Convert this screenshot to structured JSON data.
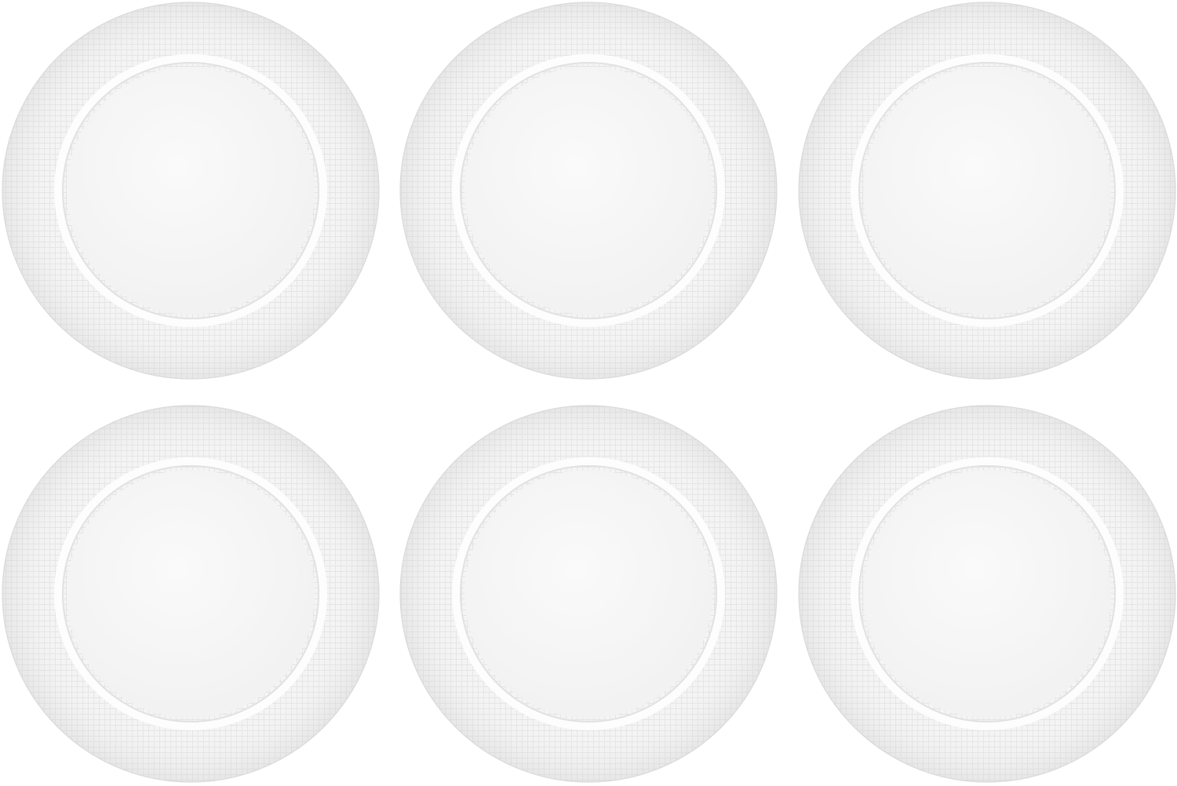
{
  "scene": {
    "subject": "white-plate",
    "count": 6,
    "rows": 2,
    "columns": 3,
    "colors": {
      "background": "#ffffff",
      "rim": "#f4f4f4",
      "rim_texture": "#e6e6e6",
      "rim_edge": "#dcdcdc",
      "well": "#f6f6f6",
      "well_ring_shadow": "#e2e2e2",
      "well_ring_highlight": "#fdfdfd"
    }
  }
}
